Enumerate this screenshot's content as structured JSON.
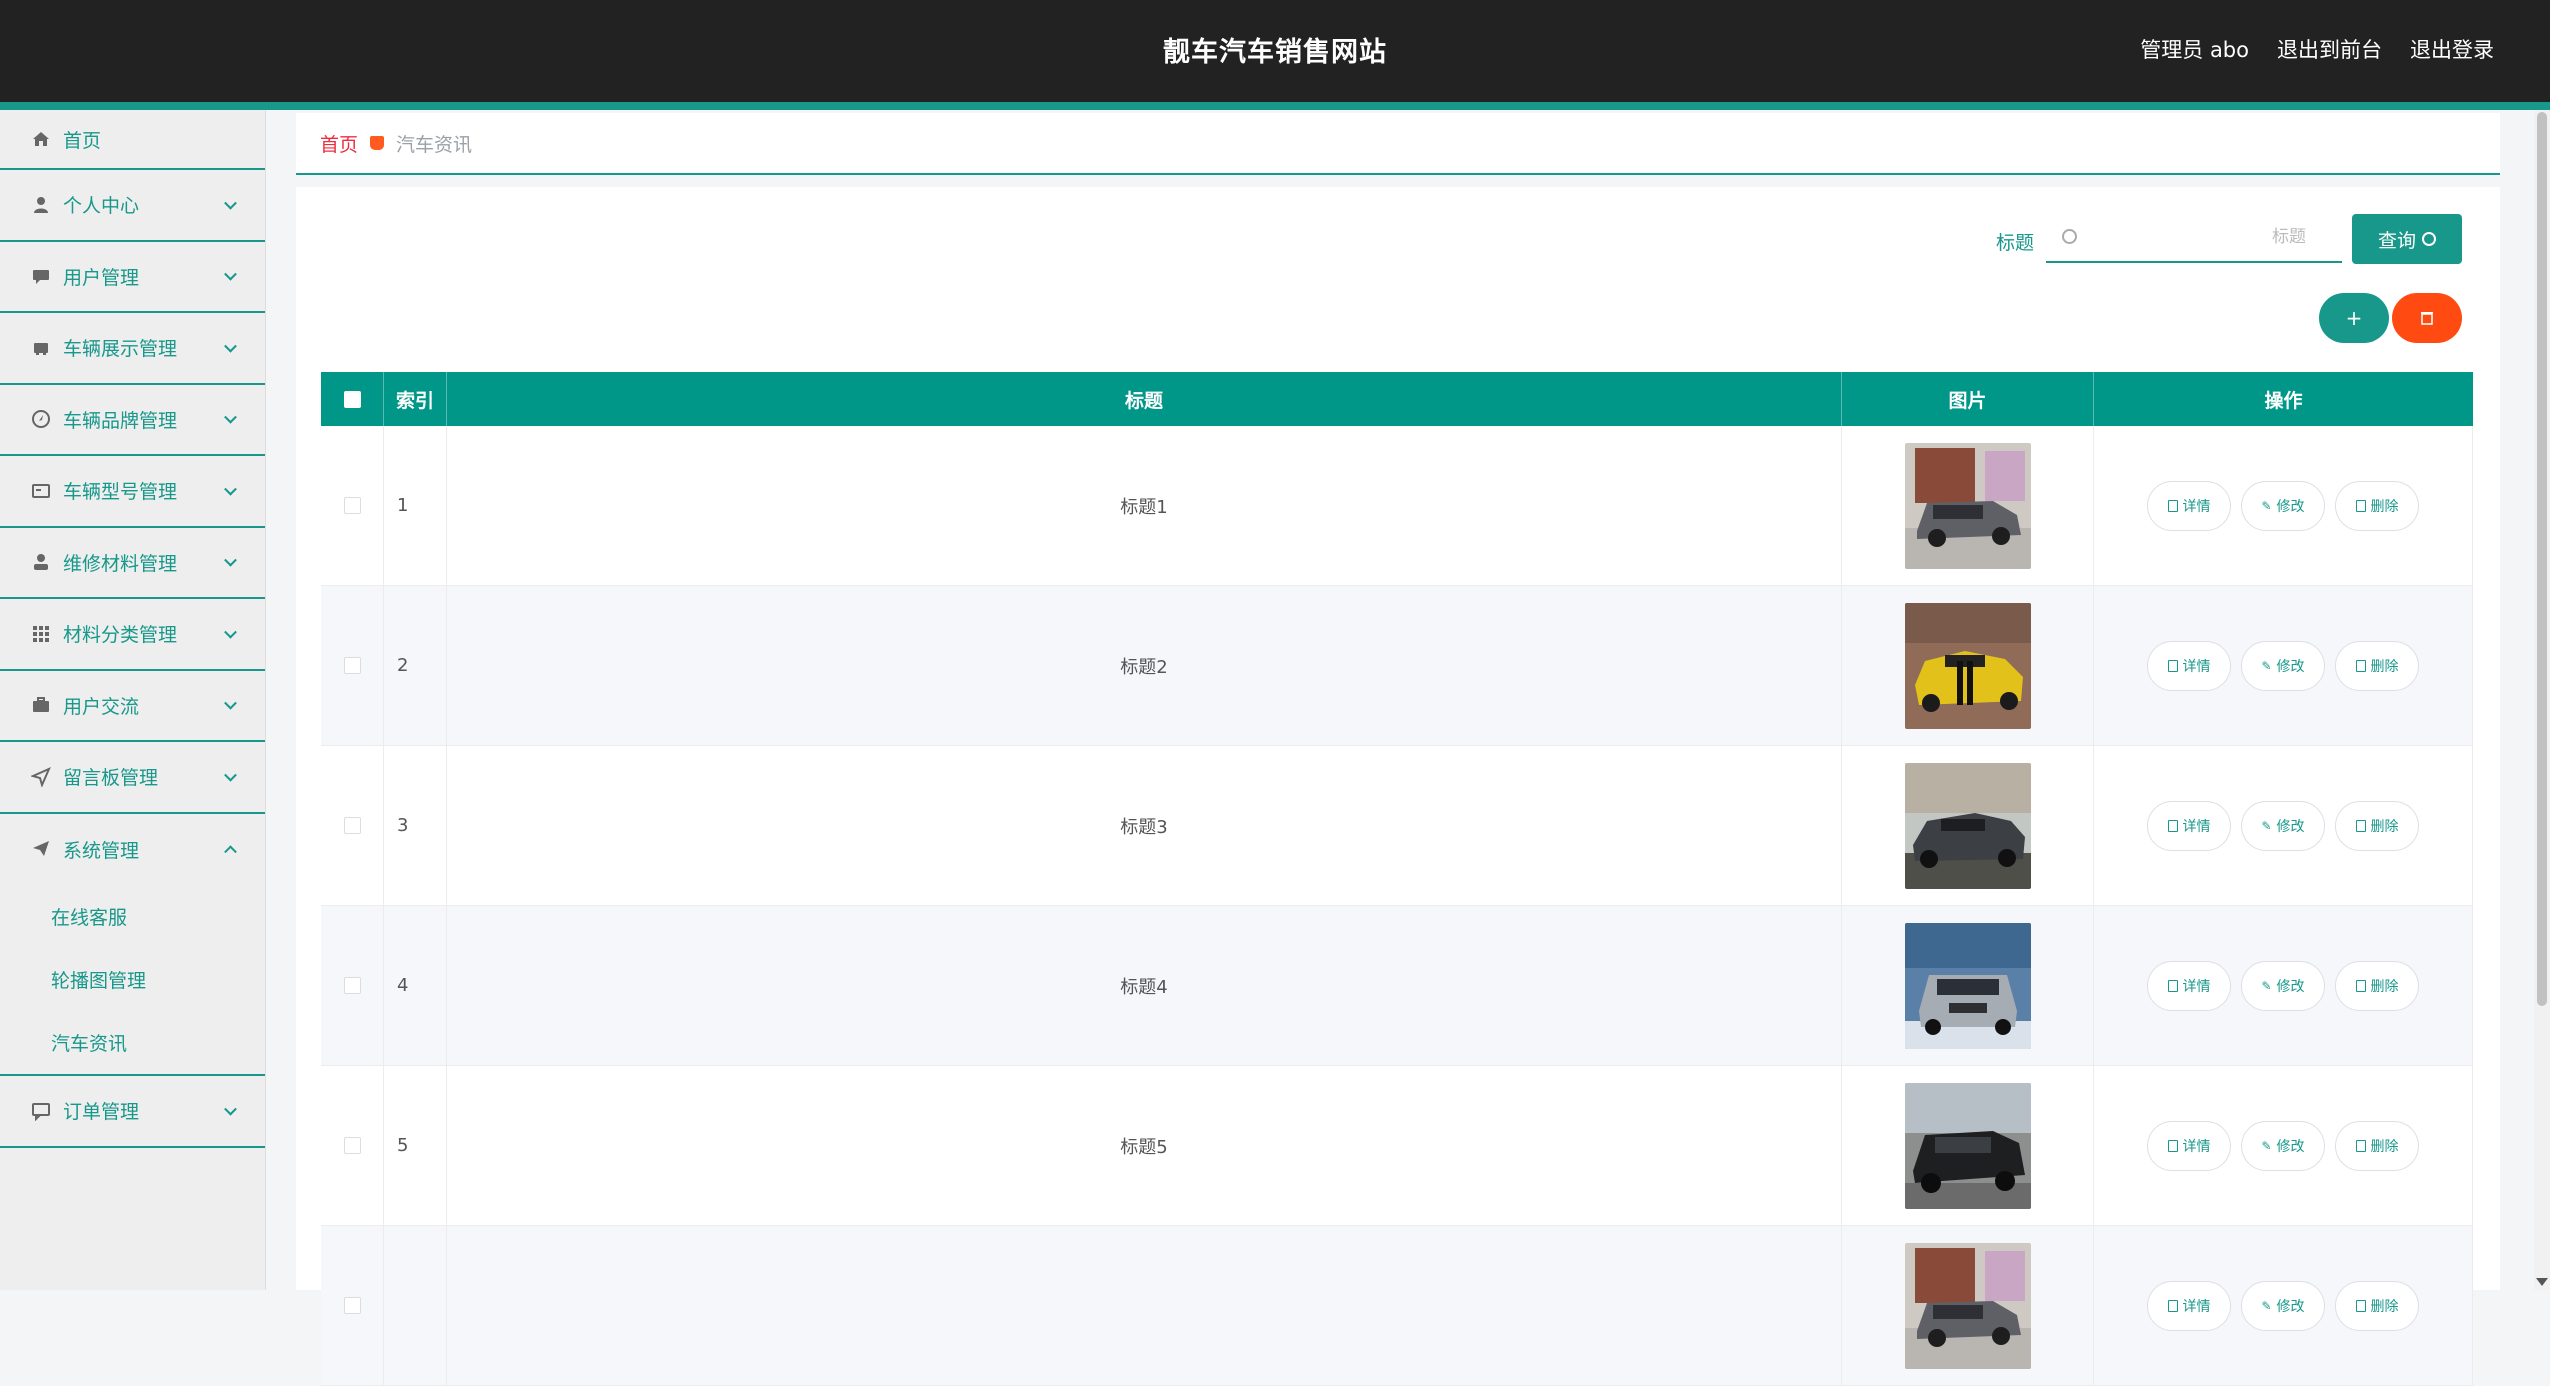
{
  "header": {
    "title": "靓车汽车销售网站",
    "admin_label": "管理员 abo",
    "exit_front": "退出到前台",
    "logout": "退出登录"
  },
  "sidebar": {
    "items": [
      {
        "label": "首页",
        "icon": "home-icon"
      },
      {
        "label": "个人中心",
        "icon": "user-icon"
      },
      {
        "label": "用户管理",
        "icon": "chat-icon"
      },
      {
        "label": "车辆展示管理",
        "icon": "car-icon"
      },
      {
        "label": "车辆品牌管理",
        "icon": "compass-icon"
      },
      {
        "label": "车辆型号管理",
        "icon": "card-icon"
      },
      {
        "label": "维修材料管理",
        "icon": "person-icon"
      },
      {
        "label": "材料分类管理",
        "icon": "grid-icon"
      },
      {
        "label": "用户交流",
        "icon": "briefcase-icon"
      },
      {
        "label": "留言板管理",
        "icon": "send-icon"
      },
      {
        "label": "系统管理",
        "icon": "paper-plane-icon"
      },
      {
        "label": "订单管理",
        "icon": "comment-icon"
      }
    ],
    "system_sub": [
      "在线客服",
      "轮播图管理",
      "汽车资讯"
    ]
  },
  "breadcrumb": {
    "home": "首页",
    "current": "汽车资讯"
  },
  "search": {
    "label": "标题",
    "placeholder": "标题",
    "button": "查询"
  },
  "table": {
    "headers": {
      "index": "索引",
      "title": "标题",
      "image": "图片",
      "action": "操作"
    },
    "rows": [
      {
        "index": "1",
        "title": "标题1",
        "img": "minivan"
      },
      {
        "index": "2",
        "title": "标题2",
        "img": "yellow-sports"
      },
      {
        "index": "3",
        "title": "标题3",
        "img": "gray-muscle"
      },
      {
        "index": "4",
        "title": "标题4",
        "img": "silver-suv"
      },
      {
        "index": "5",
        "title": "标题5",
        "img": "black-suv"
      },
      {
        "index": "",
        "title": "",
        "img": "minivan"
      }
    ],
    "actions": {
      "detail": "详情",
      "edit": "修改",
      "delete": "删除"
    }
  },
  "colors": {
    "primary": "#17988a",
    "header_bg": "#222222",
    "danger": "#ff4b12",
    "breadcrumb_home": "#ee2d3e"
  }
}
